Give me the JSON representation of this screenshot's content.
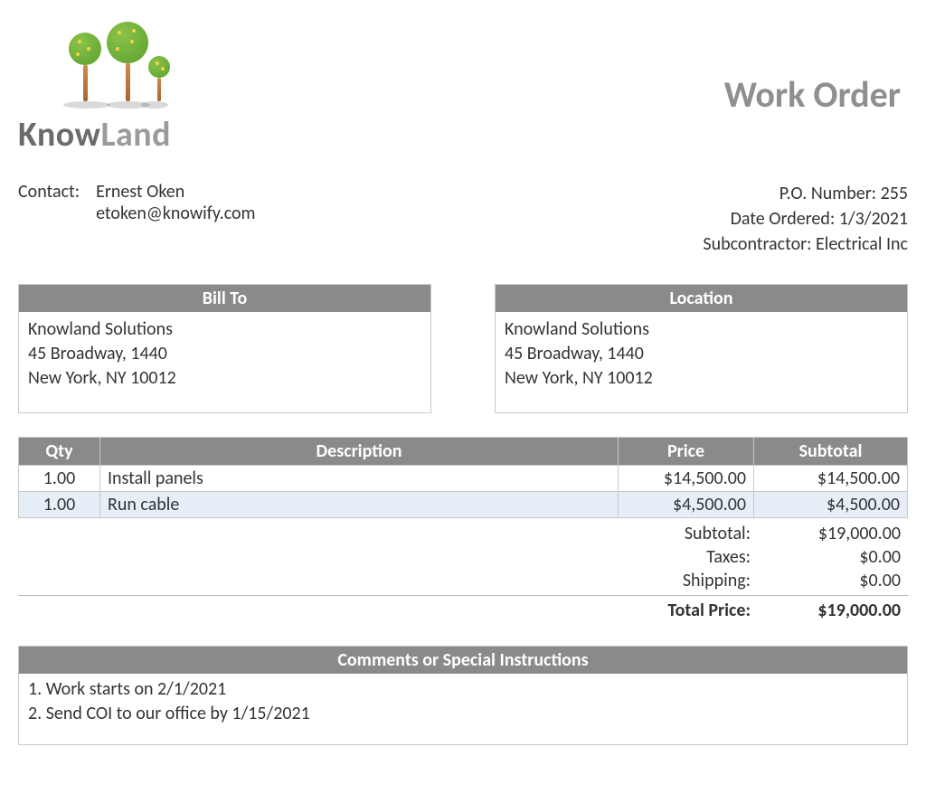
{
  "brand": {
    "part1": "Know",
    "part2": "Land"
  },
  "doc_title": "Work Order",
  "contact": {
    "label": "Contact:",
    "name": "Ernest Oken",
    "email": "etoken@knowify.com"
  },
  "meta": {
    "po_label": "P.O. Number:",
    "po_value": "255",
    "date_label": "Date Ordered:",
    "date_value": "1/3/2021",
    "sub_label": "Subcontractor:",
    "sub_value": "Electrical Inc"
  },
  "bill_to": {
    "header": "Bill To",
    "line1": "Knowland Solutions",
    "line2": "45 Broadway, 1440",
    "line3": "New York, NY 10012"
  },
  "location": {
    "header": "Location",
    "line1": "Knowland Solutions",
    "line2": "45 Broadway, 1440",
    "line3": "New York, NY 10012"
  },
  "table": {
    "headers": {
      "qty": "Qty",
      "desc": "Description",
      "price": "Price",
      "sub": "Subtotal"
    },
    "rows": [
      {
        "qty": "1.00",
        "desc": "Install panels",
        "price": "$14,500.00",
        "sub": "$14,500.00"
      },
      {
        "qty": "1.00",
        "desc": "Run cable",
        "price": "$4,500.00",
        "sub": "$4,500.00"
      }
    ]
  },
  "totals": {
    "subtotal_label": "Subtotal:",
    "subtotal_value": "$19,000.00",
    "taxes_label": "Taxes:",
    "taxes_value": "$0.00",
    "shipping_label": "Shipping:",
    "shipping_value": "$0.00",
    "total_label": "Total Price:",
    "total_value": "$19,000.00"
  },
  "comments": {
    "header": "Comments or Special Instructions",
    "line1": "1. Work starts on 2/1/2021",
    "line2": "2. Send COI to our office by 1/15/2021"
  }
}
